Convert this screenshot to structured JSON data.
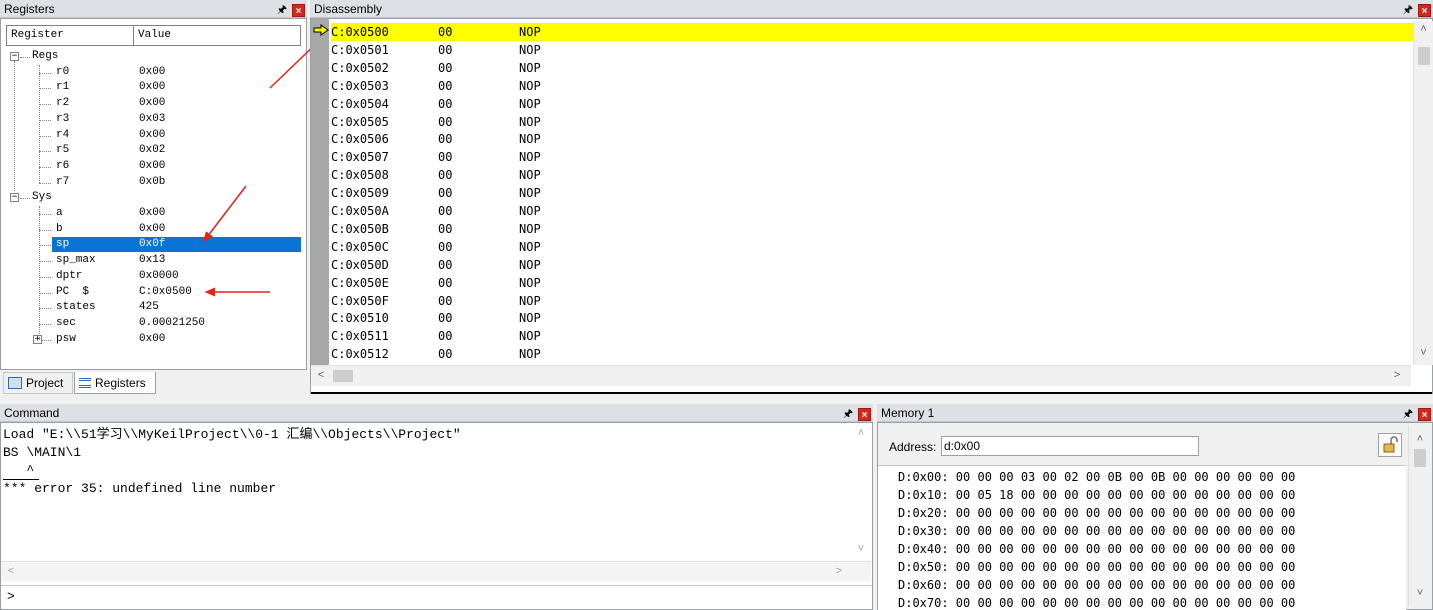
{
  "registers": {
    "title": "Registers",
    "columns": [
      "Register",
      "Value"
    ],
    "groups": [
      {
        "label": "Regs",
        "expander": "−",
        "items": [
          {
            "name": "r0",
            "value": "0x00"
          },
          {
            "name": "r1",
            "value": "0x00"
          },
          {
            "name": "r2",
            "value": "0x00"
          },
          {
            "name": "r3",
            "value": "0x03"
          },
          {
            "name": "r4",
            "value": "0x00"
          },
          {
            "name": "r5",
            "value": "0x02"
          },
          {
            "name": "r6",
            "value": "0x00"
          },
          {
            "name": "r7",
            "value": "0x0b"
          }
        ]
      },
      {
        "label": "Sys",
        "expander": "−",
        "items": [
          {
            "name": "a",
            "value": "0x00"
          },
          {
            "name": "b",
            "value": "0x00"
          },
          {
            "name": "sp",
            "value": "0x0f",
            "selected": true
          },
          {
            "name": "sp_max",
            "value": "0x13"
          },
          {
            "name": "dptr",
            "value": "0x0000"
          },
          {
            "name": "PC  $",
            "value": "C:0x0500"
          },
          {
            "name": "states",
            "value": "425"
          },
          {
            "name": "sec",
            "value": "0.00021250"
          },
          {
            "name": "psw",
            "value": "0x00",
            "expander": "+"
          }
        ]
      }
    ],
    "tabs": [
      {
        "label": "Project",
        "icon": "project-icon"
      },
      {
        "label": "Registers",
        "icon": "registers-icon",
        "active": true
      }
    ]
  },
  "disassembly": {
    "title": "Disassembly",
    "rows": [
      {
        "addr": "C:0x0500",
        "op": "00",
        "mn": "NOP",
        "current": true
      },
      {
        "addr": "C:0x0501",
        "op": "00",
        "mn": "NOP"
      },
      {
        "addr": "C:0x0502",
        "op": "00",
        "mn": "NOP"
      },
      {
        "addr": "C:0x0503",
        "op": "00",
        "mn": "NOP"
      },
      {
        "addr": "C:0x0504",
        "op": "00",
        "mn": "NOP"
      },
      {
        "addr": "C:0x0505",
        "op": "00",
        "mn": "NOP"
      },
      {
        "addr": "C:0x0506",
        "op": "00",
        "mn": "NOP"
      },
      {
        "addr": "C:0x0507",
        "op": "00",
        "mn": "NOP"
      },
      {
        "addr": "C:0x0508",
        "op": "00",
        "mn": "NOP"
      },
      {
        "addr": "C:0x0509",
        "op": "00",
        "mn": "NOP"
      },
      {
        "addr": "C:0x050A",
        "op": "00",
        "mn": "NOP"
      },
      {
        "addr": "C:0x050B",
        "op": "00",
        "mn": "NOP"
      },
      {
        "addr": "C:0x050C",
        "op": "00",
        "mn": "NOP"
      },
      {
        "addr": "C:0x050D",
        "op": "00",
        "mn": "NOP"
      },
      {
        "addr": "C:0x050E",
        "op": "00",
        "mn": "NOP"
      },
      {
        "addr": "C:0x050F",
        "op": "00",
        "mn": "NOP"
      },
      {
        "addr": "C:0x0510",
        "op": "00",
        "mn": "NOP"
      },
      {
        "addr": "C:0x0511",
        "op": "00",
        "mn": "NOP"
      },
      {
        "addr": "C:0x0512",
        "op": "00",
        "mn": "NOP"
      }
    ]
  },
  "command": {
    "title": "Command",
    "lines": [
      "Load \"E:\\\\51学习\\\\MyKeilProject\\\\0-1 汇编\\\\Objects\\\\Project\"",
      "BS \\MAIN\\1",
      "   ^",
      "*** error 35: undefined line number"
    ],
    "prompt": ">"
  },
  "memory": {
    "title": "Memory 1",
    "address_label": "Address:",
    "address_value": "d:0x00",
    "rows": [
      "D:0x00: 00 00 00 03 00 02 00 0B 00 0B 00 00 00 00 00 00",
      "D:0x10: 00 05 18 00 00 00 00 00 00 00 00 00 00 00 00 00",
      "D:0x20: 00 00 00 00 00 00 00 00 00 00 00 00 00 00 00 00",
      "D:0x30: 00 00 00 00 00 00 00 00 00 00 00 00 00 00 00 00",
      "D:0x40: 00 00 00 00 00 00 00 00 00 00 00 00 00 00 00 00",
      "D:0x50: 00 00 00 00 00 00 00 00 00 00 00 00 00 00 00 00",
      "D:0x60: 00 00 00 00 00 00 00 00 00 00 00 00 00 00 00 00",
      "D:0x70: 00 00 00 00 00 00 00 00 00 00 00 00 00 00 00 00"
    ]
  },
  "colors": {
    "highlight": "#ffff00",
    "selection": "#0a74d6",
    "annotation_arrow": "#e8201a",
    "close_button": "#d9261c"
  },
  "icons": {
    "pin": "pin-icon",
    "close": "close-icon",
    "current_line": "current-line-arrow-icon",
    "lock": "lock-icon"
  }
}
